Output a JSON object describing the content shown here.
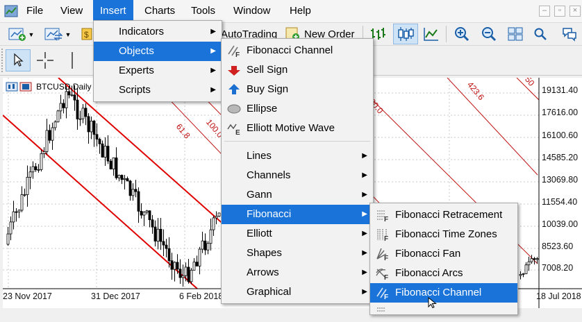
{
  "menubar": {
    "items": [
      "File",
      "View",
      "Insert",
      "Charts",
      "Tools",
      "Window",
      "Help"
    ],
    "active": "Insert"
  },
  "toolbar": {
    "autotrading_label": "AutoTrading",
    "new_order_label": "New Order"
  },
  "chart": {
    "symbol_label": "BTCUSD,Daily",
    "price_labels": [
      "19131.40",
      "17616.00",
      "16100.60",
      "14585.20",
      "13069.80",
      "11554.40",
      "10039.00",
      "8523.60",
      "7008.20"
    ],
    "date_labels": [
      "23 Nov 2017",
      "31 Dec 2017",
      "6 Feb 2018",
      "18 Jul 2018"
    ],
    "fib_labels": [
      "61.8",
      "100.0",
      "423.6",
      "00.0",
      "50"
    ],
    "colors": {
      "channel": "#e00000",
      "fib": "#c01010",
      "grid": "#c8c8c8"
    }
  },
  "insert_menu": {
    "items": [
      {
        "label": "Indicators",
        "submenu": true
      },
      {
        "label": "Objects",
        "submenu": true
      },
      {
        "label": "Experts",
        "submenu": true
      },
      {
        "label": "Scripts",
        "submenu": true
      }
    ],
    "highlighted": "Objects"
  },
  "objects_menu": {
    "top_items": [
      {
        "label": "Fibonacci Channel",
        "icon": "fib-channel-icon"
      },
      {
        "label": "Sell Sign",
        "icon": "sell-sign-icon"
      },
      {
        "label": "Buy Sign",
        "icon": "buy-sign-icon"
      },
      {
        "label": "Ellipse",
        "icon": "ellipse-icon"
      },
      {
        "label": "Elliott Motive Wave",
        "icon": "elliott-wave-icon"
      }
    ],
    "groups": [
      "Lines",
      "Channels",
      "Gann",
      "Fibonacci",
      "Elliott",
      "Shapes",
      "Arrows",
      "Graphical"
    ],
    "highlighted": "Fibonacci"
  },
  "fibonacci_menu": {
    "items": [
      {
        "label": "Fibonacci Retracement",
        "icon": "fib-retracement-icon"
      },
      {
        "label": "Fibonacci Time Zones",
        "icon": "fib-time-zones-icon"
      },
      {
        "label": "Fibonacci Fan",
        "icon": "fib-fan-icon"
      },
      {
        "label": "Fibonacci Arcs",
        "icon": "fib-arcs-icon"
      },
      {
        "label": "Fibonacci Channel",
        "icon": "fib-channel-icon"
      }
    ],
    "highlighted": "Fibonacci Channel"
  }
}
